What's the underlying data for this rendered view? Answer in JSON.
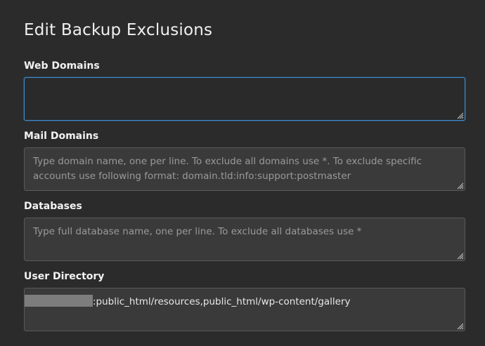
{
  "page": {
    "title": "Edit Backup Exclusions"
  },
  "fields": {
    "web_domains": {
      "label": "Web Domains",
      "value": "",
      "placeholder": ""
    },
    "mail_domains": {
      "label": "Mail Domains",
      "value": "",
      "placeholder": "Type domain name, one per line. To exclude all domains use *. To exclude specific accounts use following format: domain.tld:info:support:postmaster"
    },
    "databases": {
      "label": "Databases",
      "value": "",
      "placeholder": "Type full database name, one per line. To exclude all databases use *"
    },
    "user_directory": {
      "label": "User Directory",
      "value": ":public_html/resources,public_html/wp-content/gallery"
    }
  },
  "icons": {
    "resize_grip": "resize-grip-icon"
  },
  "colors": {
    "background": "#2b2b2b",
    "field_background": "#3a3a3a",
    "focus_border": "#3d8fd6",
    "placeholder_text": "#9a9a9a"
  }
}
